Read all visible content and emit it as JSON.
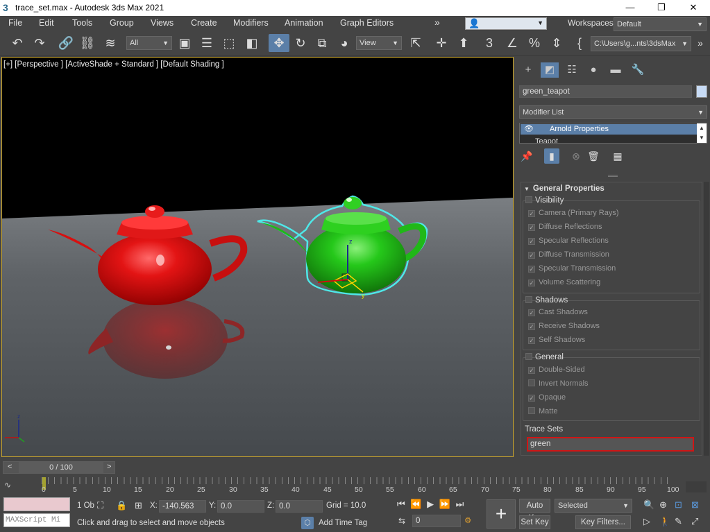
{
  "title": "trace_set.max - Autodesk 3ds Max 2021",
  "window_controls": {
    "minimize": "—",
    "maximize": "❐",
    "close": "✕"
  },
  "menu": [
    "File",
    "Edit",
    "Tools",
    "Group",
    "Views",
    "Create",
    "Modifiers",
    "Animation",
    "Graph Editors"
  ],
  "menu_more": "»",
  "workspaces_label": "Workspaces:",
  "workspace_value": "Default",
  "toolbar": {
    "filter_value": "All",
    "ref_coord_value": "View",
    "project_path": "C:\\Users\\g...nts\\3dsMax",
    "icons": [
      "undo-icon",
      "redo-icon",
      "link-icon",
      "unlink-icon",
      "bind-spacewarp-icon",
      "select-object-icon",
      "select-by-name-icon",
      "rect-region-icon",
      "window-crossing-icon",
      "move-icon",
      "rotate-icon",
      "scale-icon",
      "placement-icon",
      "pivot-icon",
      "snap-icon",
      "angle-snap-icon",
      "percent-snap-icon",
      "spinner-snap-icon"
    ]
  },
  "viewport": {
    "label": "[+] [Perspective ] [ActiveShade + Standard ] [Default Shading ]",
    "colors": {
      "background_top": "#000000",
      "floor": "#5a5e62",
      "red_teapot": "#e01010",
      "green_teapot": "#22c418",
      "selection_outline": "#4ee8e8"
    },
    "gizmo": {
      "z": "z",
      "y": "y"
    }
  },
  "command_panel": {
    "object_name": "green_teapot",
    "object_color": "#c7dbf5",
    "modifier_list_label": "Modifier List",
    "stack": [
      "Arnold Properties",
      "Teapot"
    ],
    "rollout_title": "General Properties",
    "visibility": {
      "label": "Visibility",
      "items": [
        {
          "label": "Camera (Primary Rays)",
          "checked": true
        },
        {
          "label": "Diffuse Reflections",
          "checked": true
        },
        {
          "label": "Specular Reflections",
          "checked": true
        },
        {
          "label": "Diffuse Transmission",
          "checked": true
        },
        {
          "label": "Specular Transmission",
          "checked": true
        },
        {
          "label": "Volume Scattering",
          "checked": true
        }
      ]
    },
    "shadows": {
      "label": "Shadows",
      "items": [
        {
          "label": "Cast Shadows",
          "checked": true
        },
        {
          "label": "Receive Shadows",
          "checked": true
        },
        {
          "label": "Self Shadows",
          "checked": true
        }
      ]
    },
    "general": {
      "label": "General",
      "items": [
        {
          "label": "Double-Sided",
          "checked": true
        },
        {
          "label": "Invert Normals",
          "checked": false
        },
        {
          "label": "Opaque",
          "checked": true
        },
        {
          "label": "Matte",
          "checked": false
        }
      ]
    },
    "trace_sets": {
      "label": "Trace Sets",
      "value": "green"
    }
  },
  "timeline": {
    "frame_counter": "0 / 100",
    "prev": "<",
    "next": ">",
    "ticks": [
      "0",
      "5",
      "10",
      "15",
      "20",
      "25",
      "30",
      "35",
      "40",
      "45",
      "50",
      "55",
      "60",
      "65",
      "70",
      "75",
      "80",
      "85",
      "90",
      "95",
      "100"
    ]
  },
  "status": {
    "maxscript_placeholder": "MAXScript Mi",
    "selection_count": "1 Ob",
    "prompt": "Click and drag to select and move objects",
    "x_label": "X:",
    "x_value": "-140.563",
    "y_label": "Y:",
    "y_value": "0.0",
    "z_label": "Z:",
    "z_value": "0.0",
    "grid": "Grid = 10.0",
    "add_time_tag": "Add Time Tag",
    "frame_value": "0",
    "auto_key": "Auto K...",
    "set_key": "Set Key",
    "selected_value": "Selected",
    "key_filters": "Key Filters..."
  }
}
